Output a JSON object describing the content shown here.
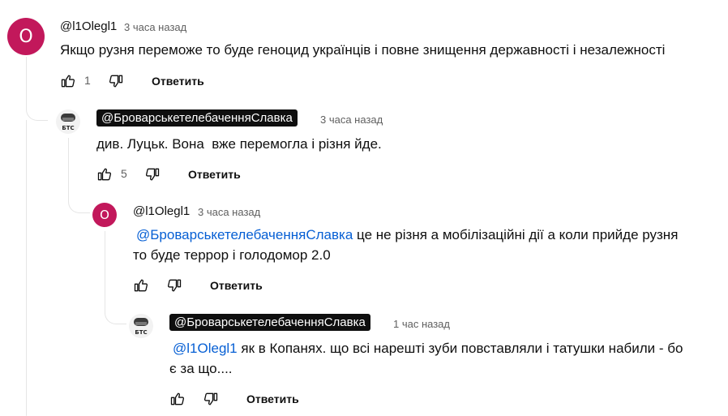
{
  "comments": [
    {
      "avatar_letter": "О",
      "author": "@l1Olegl1",
      "time": "3 часа назад",
      "text": "Якщо рузня переможе то буде геноцид українців і повне знищення державності і незалежності",
      "likes": "1",
      "reply_label": "Ответить"
    },
    {
      "avatar_text": "БТС",
      "author": "@БроварськетелебаченняСлавка",
      "time": "3 часа назад",
      "text": "див. Луцьк. Вона  вже перемогла і різня йде.",
      "likes": "5",
      "reply_label": "Ответить"
    },
    {
      "avatar_letter": "О",
      "author": "@l1Olegl1",
      "time": "3 часа назад",
      "mention": "@БроварськетелебаченняСлавка",
      "text_line1": " це не різня а мобілізаційні дії а коли прийде рузня",
      "text_line2": "то буде террор і голодомор 2.0",
      "reply_label": "Ответить"
    },
    {
      "avatar_text": "БТС",
      "author": "@БроварськетелебаченняСлавка",
      "time": "1 час назад",
      "mention": "@l1Olegl1",
      "text_line1": " як в Копанях. що всі нарешті зуби повставляли і татушки набили - бо",
      "text_line2": "є за що....",
      "reply_label": "Ответить"
    }
  ],
  "colors": {
    "avatar": "#c2185b",
    "mention": "#065fd4",
    "tag_bg": "#0f0f0f"
  }
}
